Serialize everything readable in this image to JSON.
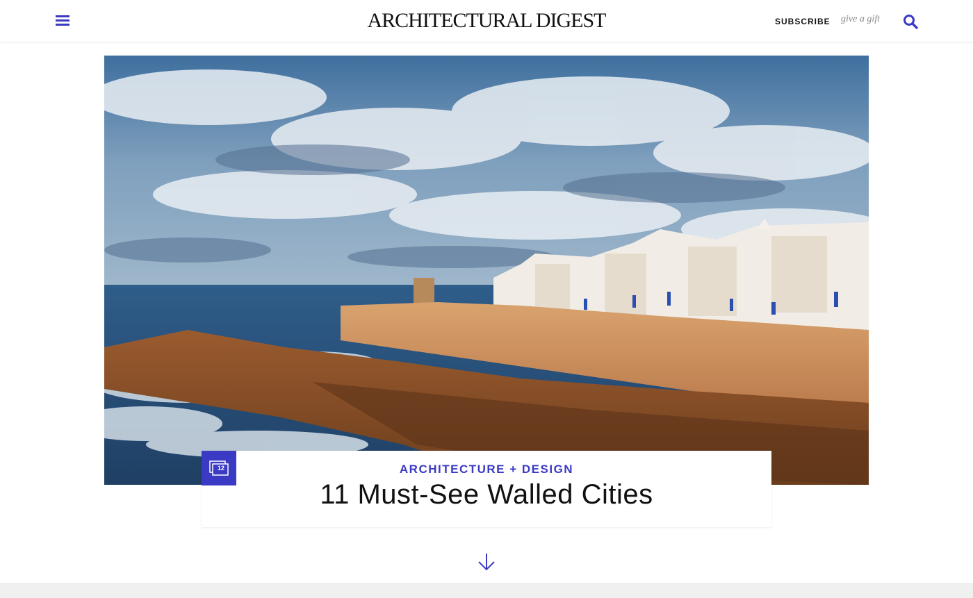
{
  "header": {
    "logo": "ARCHITECTURAL DIGEST",
    "subscribe_label": "SUBSCRIBE",
    "gift_label": "give a gift",
    "menu_icon": "hamburger-menu-icon",
    "search_icon": "search-icon"
  },
  "hero": {
    "category": "ARCHITECTURE + DESIGN",
    "title": "11 Must-See Walled Cities",
    "gallery_count": "12"
  },
  "colors": {
    "accent": "#3a3ac4",
    "text": "#111111",
    "muted": "#888888"
  },
  "icons": {
    "scroll": "chevron-down-arrow-icon",
    "gallery": "gallery-icon"
  }
}
